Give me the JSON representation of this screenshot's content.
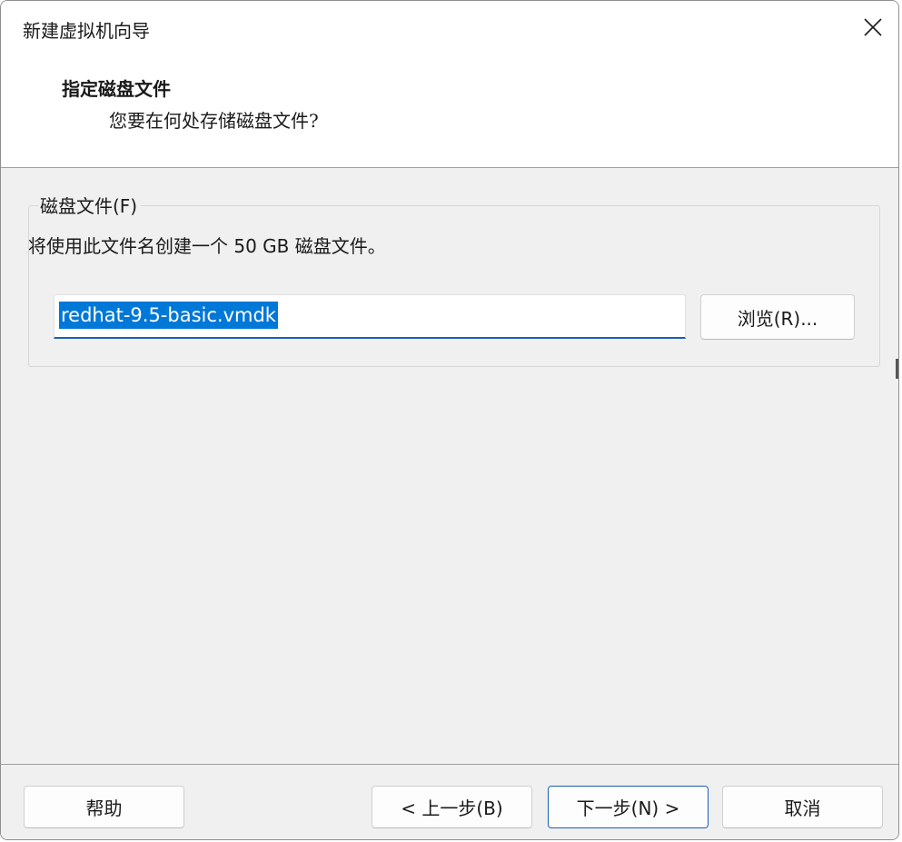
{
  "window": {
    "title": "新建虚拟机向导",
    "close_icon": "close-icon"
  },
  "header": {
    "title": "指定磁盘文件",
    "subtitle": "您要在何处存储磁盘文件?"
  },
  "disk_file": {
    "group_label": "磁盘文件(F)",
    "description": "将使用此文件名创建一个 50 GB 磁盘文件。",
    "filename_value": "redhat-9.5-basic.vmdk",
    "browse_label": "浏览(R)..."
  },
  "footer": {
    "help_label": "帮助",
    "back_label": "< 上一步(B)",
    "next_label": "下一步(N) >",
    "cancel_label": "取消"
  },
  "colors": {
    "selection": "#0078d7",
    "focus_border": "#1a5fb4",
    "body_bg": "#f0f0f0"
  }
}
